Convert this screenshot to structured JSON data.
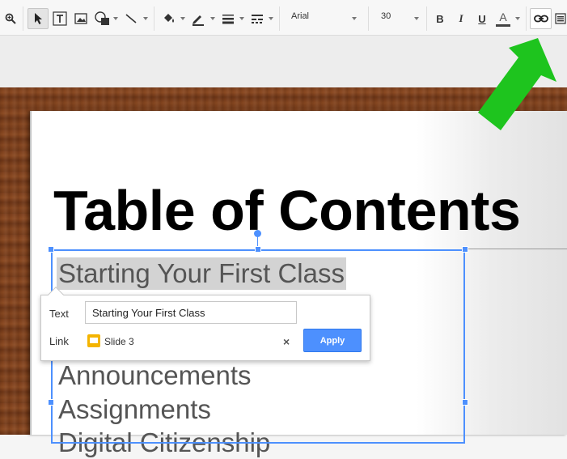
{
  "toolbar": {
    "font_name": "Arial",
    "font_size": "30",
    "bold_label": "B",
    "italic_label": "I",
    "underline_label": "U",
    "text_color_label": "A",
    "icons": [
      "zoom-icon",
      "select-arrow-icon",
      "textbox-icon",
      "image-icon",
      "shape-icon",
      "line-icon",
      "fill-color-icon",
      "line-color-icon",
      "line-weight-icon",
      "line-dash-icon",
      "link-icon",
      "align-icon"
    ]
  },
  "slide": {
    "title": "Table of Contents",
    "items": [
      "Starting Your First Class",
      "Announcements",
      "Assignments",
      "Digital Citizenship"
    ]
  },
  "link_popup": {
    "text_label": "Text",
    "text_value": "Starting Your First Class",
    "link_label": "Link",
    "link_value": "Slide 3",
    "close_label": "×",
    "apply_label": "Apply"
  },
  "colors": {
    "accent": "#4d90fe",
    "arrow": "#1ec41e",
    "slide_chip": "#f4b400"
  }
}
